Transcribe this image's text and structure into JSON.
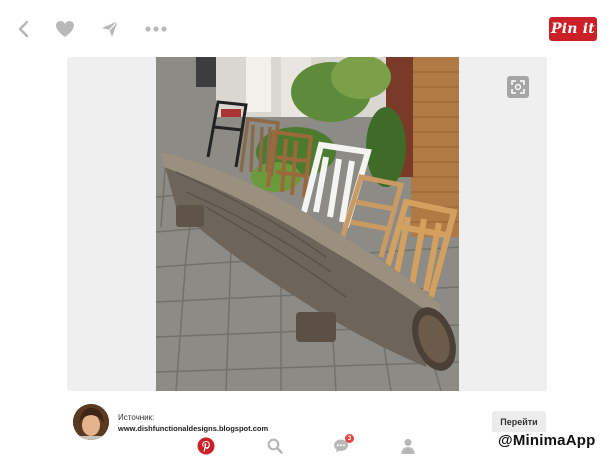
{
  "toolbar": {
    "back_icon": "chevron-left-icon",
    "like_icon": "heart-icon",
    "send_icon": "paper-plane-icon",
    "more_icon": "more-dots-icon",
    "pin_it_label": "Pin it"
  },
  "pin": {
    "image_icon": "photo",
    "zoom_icon": "expand-icon"
  },
  "source": {
    "label": "Источник:",
    "url": "www.dishfunctionaldesigns.blogspot.com",
    "goto_label": "Перейти"
  },
  "bottom_nav": {
    "items": [
      {
        "icon": "pinterest-logo-icon",
        "active": true
      },
      {
        "icon": "search-icon",
        "active": false
      },
      {
        "icon": "chat-icon",
        "active": false,
        "badge": "3"
      },
      {
        "icon": "profile-icon",
        "active": false
      }
    ]
  },
  "watermark": "@MinimaApp",
  "colors": {
    "brand_red": "#cb2027",
    "icon_gray": "#b8b8b8",
    "panel_bg": "#efefef"
  }
}
